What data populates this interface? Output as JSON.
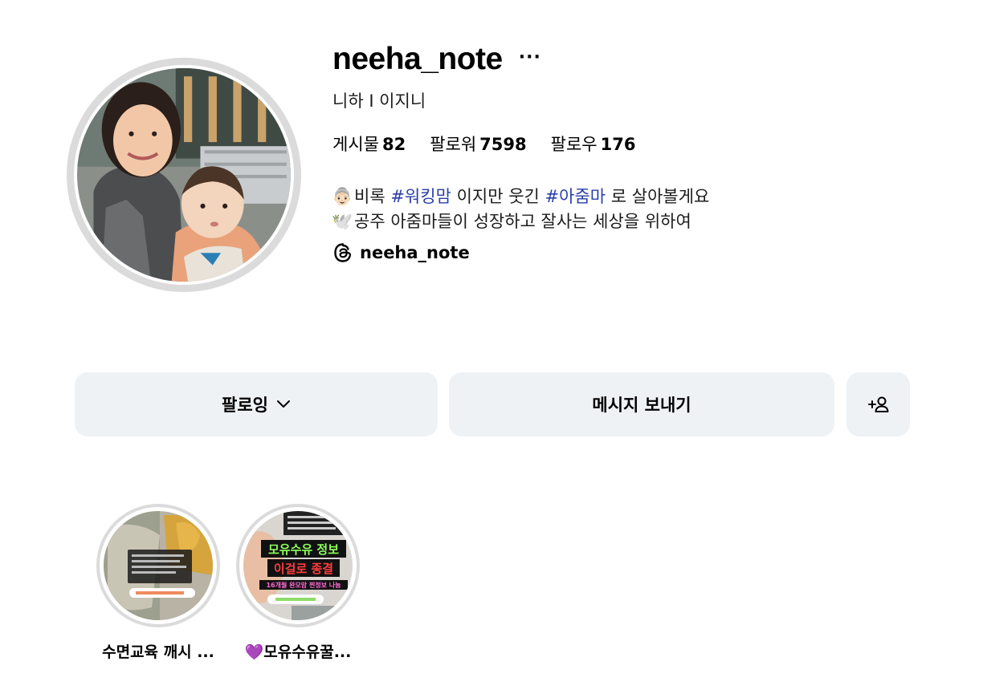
{
  "profile": {
    "username": "neeha_note",
    "more_label": "···",
    "full_name": "니하 I 이지니",
    "stats": {
      "posts_label": "게시물",
      "posts_value": "82",
      "followers_label": "팔로워",
      "followers_value": "7598",
      "following_label": "팔로우",
      "following_value": "176"
    },
    "bio": {
      "line1": {
        "emoji": "👵🏻",
        "text_a": "비록 ",
        "tag_a": "#워킹맘",
        "text_b": " 이지만 웃긴 ",
        "tag_b": "#아줌마",
        "text_c": " 로 살아볼게요"
      },
      "line2": {
        "emoji": "🕊️",
        "text": "공주 아줌마들이 성장하고 잘사는 세상을 위하여"
      }
    },
    "threads_handle": "neeha_note"
  },
  "actions": {
    "following_label": "팔로잉",
    "message_label": "메시지 보내기"
  },
  "highlights": [
    {
      "label": "수면교육 깨시 ..."
    },
    {
      "label": "💜모유수유꿀..."
    }
  ],
  "thumbnail_text": {
    "h2_line1": "모유수유 정보",
    "h2_line2": "이걸로 종결",
    "h2_line3": "16개월 완모맘 찐정보 나눔"
  },
  "colors": {
    "hashtag": "#2b3fa9",
    "button_bg": "#eff2f5",
    "ring": "#dbdbdb"
  }
}
